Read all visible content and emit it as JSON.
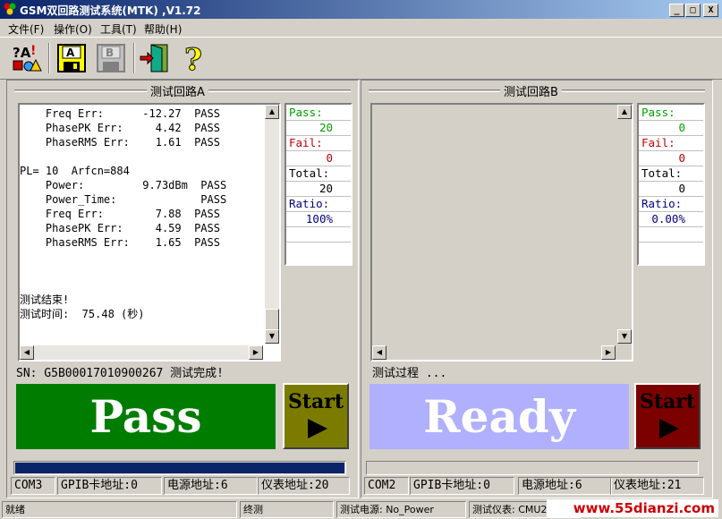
{
  "window": {
    "title": "GSM双回路测试系统(MTK) ,V1.72",
    "btn_min": "_",
    "btn_max": "□",
    "btn_close": "X"
  },
  "menu": {
    "file": "文件(F)",
    "operate": "操作(O)",
    "tools": "工具(T)",
    "help": "帮助(H)"
  },
  "toolbar": {
    "icons": [
      "test-settings-icon",
      "save-a-icon",
      "save-b-icon",
      "exit-door-icon",
      "help-question-icon"
    ]
  },
  "loopA": {
    "title": "测试回路A",
    "log": [
      "    Freq Err:      -12.27  PASS",
      "    PhasePK Err:     4.42  PASS",
      "    PhaseRMS Err:    1.61  PASS",
      "",
      "PL= 10  Arfcn=884",
      "    Power:         9.73dBm  PASS",
      "    Power_Time:             PASS",
      "    Freq Err:        7.88  PASS",
      "    PhasePK Err:     4.59  PASS",
      "    PhaseRMS Err:    1.65  PASS",
      "",
      "",
      "",
      "测试结束!",
      "测试时间:  75.48 (秒)"
    ],
    "pass_label": "Pass:",
    "pass_value": "20",
    "fail_label": "Fail:",
    "fail_value": "0",
    "total_label": "Total:",
    "total_value": "20",
    "ratio_label": "Ratio:",
    "ratio_value": "100%",
    "sn_line": "SN: G5B00017010900267  测试完成!",
    "result": "Pass",
    "start": "Start",
    "progress": 1.0,
    "com": "COM3",
    "gpib": "GPIB卡地址:0",
    "power_addr": "电源地址:6",
    "meter_addr": "仪表地址:20"
  },
  "loopB": {
    "title": "测试回路B",
    "pass_label": "Pass:",
    "pass_value": "0",
    "fail_label": "Fail:",
    "fail_value": "0",
    "total_label": "Total:",
    "total_value": "0",
    "ratio_label": "Ratio:",
    "ratio_value": "0.00%",
    "status_line": "测试过程 ...",
    "result": "Ready",
    "start": "Start",
    "progress": 0.0,
    "com": "COM2",
    "gpib": "GPIB卡地址:0",
    "power_addr": "电源地址:6",
    "meter_addr": "仪表地址:21"
  },
  "statusbar": {
    "ready": "就绪",
    "mode": "终测",
    "power": "测试电源: No_Power",
    "meter": "测试仪表: CMU200"
  },
  "watermark": "www.55dianzi.com",
  "colors": {
    "pass_green": "#007d00",
    "start_a": "#7b7b00",
    "ready_blue": "#b0b0ff",
    "start_b": "#7b0000"
  }
}
